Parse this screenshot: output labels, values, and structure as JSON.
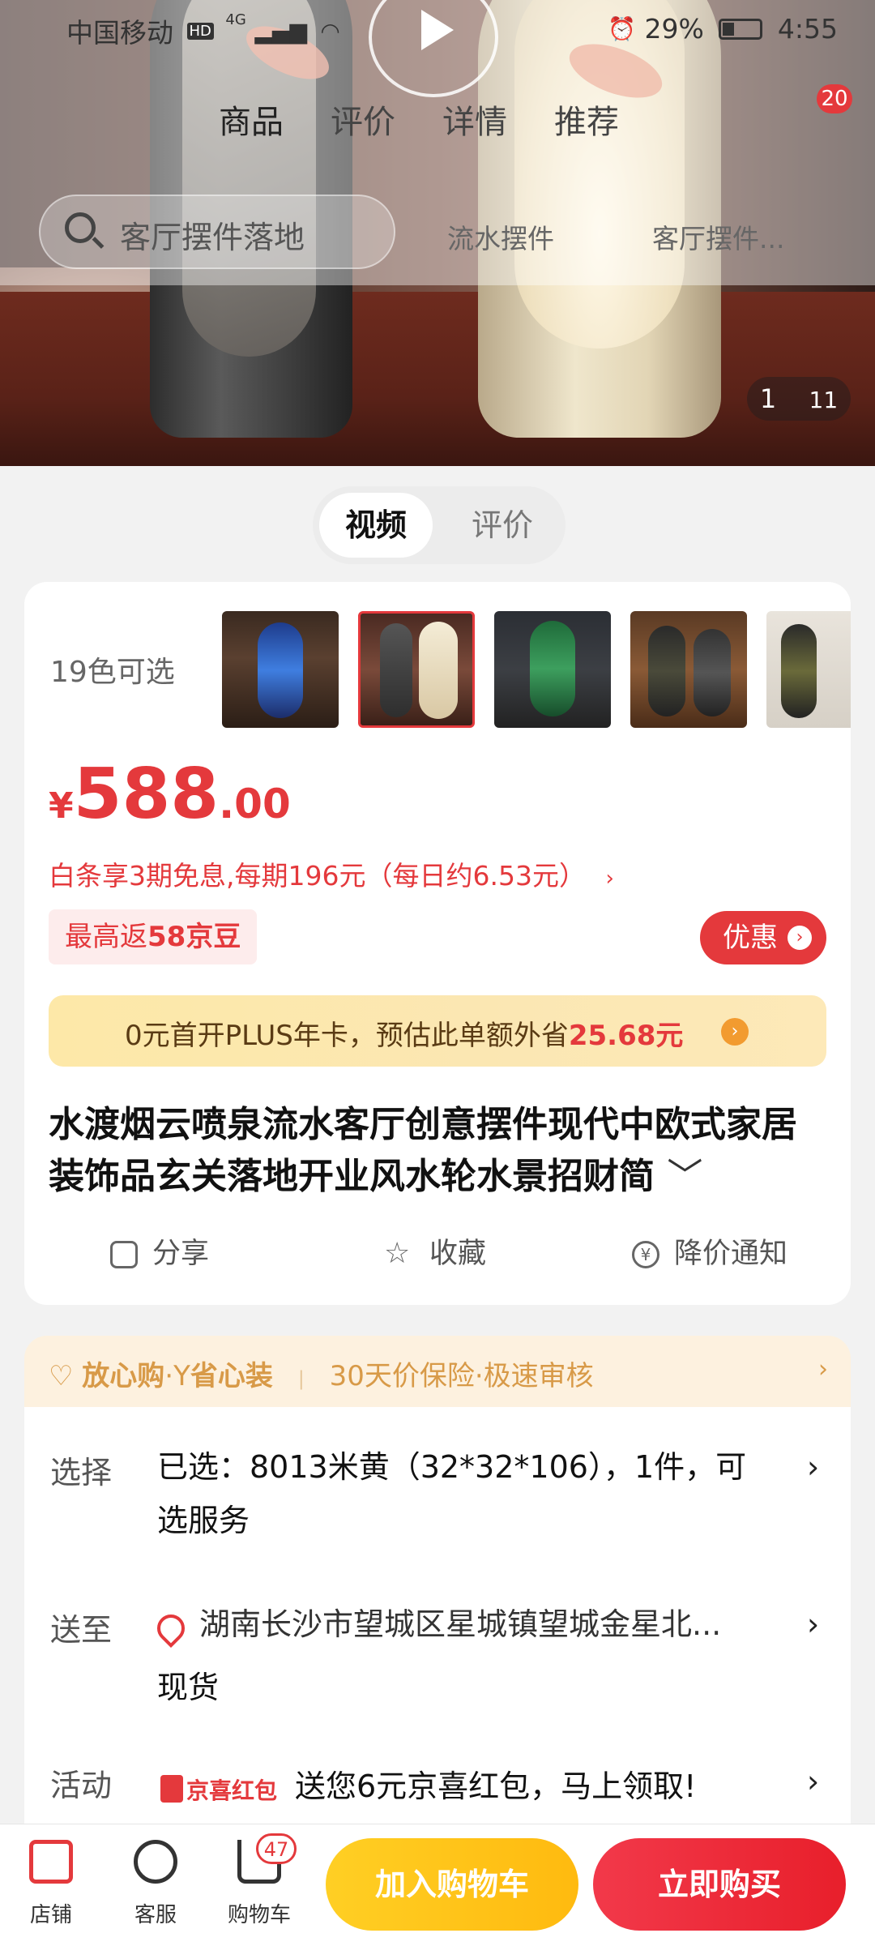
{
  "status_bar": {
    "carrier": "中国移动",
    "network": "4G",
    "battery": "29%",
    "time": "4:55"
  },
  "header": {
    "tabs": [
      "商品",
      "评价",
      "详情",
      "推荐"
    ],
    "cart_badge": "20",
    "search_placeholder": "客厅摆件落地",
    "hot_keywords": [
      "流水摆件",
      "客厅摆件..."
    ]
  },
  "gallery": {
    "counter_current": "1",
    "counter_total": "11"
  },
  "media_toggle": {
    "video": "视频",
    "review": "评价"
  },
  "product": {
    "color_count_label": "19色可选",
    "thumbnails": [
      "black-gold-vase",
      "black-cream-pair",
      "green-black-vase",
      "black-pair-indoor",
      "black-gold-small"
    ],
    "price_symbol": "¥",
    "price_integer": "588",
    "price_decimal": ".00",
    "baitiao": "白条享3期免息,每期196元（每日约6.53元）",
    "beans_prefix": "最高返",
    "beans_value": "58京豆",
    "promo_button": "优惠",
    "plus_text": "0元首开PLUS年卡，预估此单额外省",
    "plus_amount": "25.68元",
    "title": "水渡烟云喷泉流水客厅创意摆件现代中欧式家居装饰品玄关落地开业风水轮水景招财简",
    "actions": {
      "share": "分享",
      "favorite": "收藏",
      "price_alert": "降价通知"
    }
  },
  "assurance": {
    "text1": "放心购",
    "text2": "省心装",
    "text3": "30天价保险·极速审核"
  },
  "info": {
    "select_label": "选择",
    "select_text_line1": "已选：8013米黄（32*32*106），1件，可",
    "select_text_line2": "选服务",
    "ship_label": "送至",
    "ship_address": "湖南长沙市望城区星城镇望城金星北...",
    "ship_status": "现货",
    "activity_label": "活动",
    "activity_badge": "京喜红包",
    "activity_text": "送您6元京喜红包，马上领取!"
  },
  "bottom_bar": {
    "store": "店铺",
    "service": "客服",
    "cart": "购物车",
    "cart_count": "47",
    "add_to_cart": "加入购物车",
    "buy_now": "立即购买"
  },
  "colors": {
    "accent_red": "#e4393c",
    "accent_yellow": "#ffc21a",
    "plus_gold": "#f29b30"
  }
}
